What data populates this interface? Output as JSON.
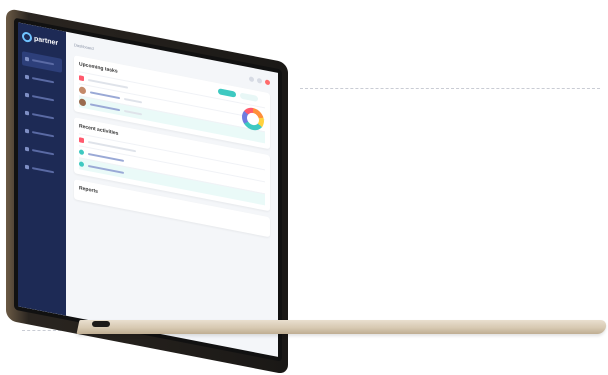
{
  "app": {
    "logo_text": "partner",
    "breadcrumb": "Dashboard"
  },
  "sidebar": {
    "items": [
      {
        "icon": "home-icon"
      },
      {
        "icon": "users-icon"
      },
      {
        "icon": "calendar-icon"
      },
      {
        "icon": "chart-icon"
      },
      {
        "icon": "settings-icon"
      },
      {
        "icon": "mail-icon"
      },
      {
        "icon": "folder-icon"
      }
    ]
  },
  "cards": {
    "tasks_title": "Upcoming tasks",
    "activities_title": "Recent activities",
    "reports_title": "Reports"
  },
  "colors": {
    "sidebar_bg": "#1d2a55",
    "accent_teal": "#3ec9c1",
    "accent_red": "#ff5a6e",
    "laptop_gold": "#d7c9b2"
  }
}
